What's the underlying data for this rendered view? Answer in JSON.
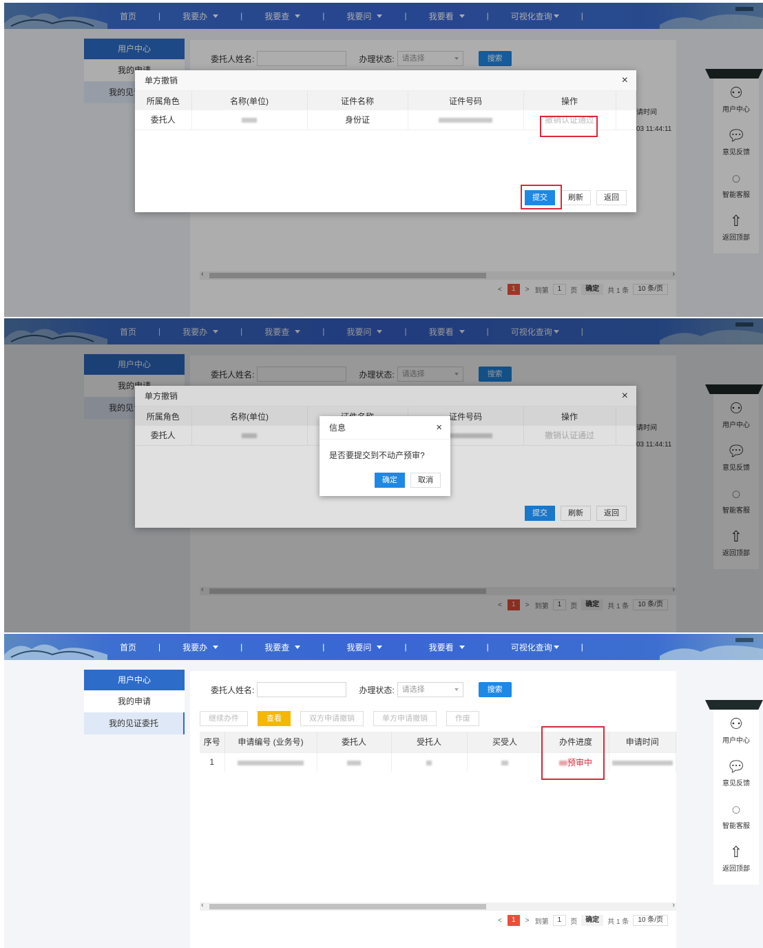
{
  "nav": {
    "items": [
      {
        "label": "首页",
        "dropdown": false
      },
      {
        "label": "我要办",
        "dropdown": true
      },
      {
        "label": "我要查",
        "dropdown": true
      },
      {
        "label": "我要问",
        "dropdown": true
      },
      {
        "label": "我要看",
        "dropdown": true
      },
      {
        "label": "可视化查询",
        "dropdown": true
      }
    ],
    "separator": "|"
  },
  "sidebar": {
    "header": "用户中心",
    "items": [
      {
        "label": "我的申请"
      },
      {
        "label": "我的见证委托"
      }
    ]
  },
  "search": {
    "client_label": "委托人姓名:",
    "status_label": "办理状态:",
    "status_placeholder": "请选择",
    "search_button": "搜索"
  },
  "toolbar": {
    "buttons": [
      "继续办件",
      "查看",
      "双方申请撤销",
      "单方申请撤销",
      "作废"
    ]
  },
  "main_table": {
    "columns": [
      "序号",
      "申请编号 (业务号)",
      "委托人",
      "受托人",
      "买受人",
      "办件进度",
      "申请时间"
    ],
    "row": {
      "index": "1",
      "progress": "预审中",
      "time_partial": "03 11:44:11"
    }
  },
  "pager": {
    "page": "1",
    "goto_label": "到第",
    "goto_value": "1",
    "page_unit": "页",
    "confirm": "确定",
    "total": "共 1 条",
    "per_page": "10 条/页"
  },
  "floatbar": {
    "items": [
      {
        "label": "用户中心",
        "icon": "user-icon"
      },
      {
        "label": "意见反馈",
        "icon": "chat-icon"
      },
      {
        "label": "智能客服",
        "icon": "headset-icon"
      },
      {
        "label": "返回顶部",
        "icon": "arrow-up-icon"
      }
    ]
  },
  "dialog": {
    "title": "单方撤销",
    "close": "×",
    "columns": [
      "所属角色",
      "名称(单位)",
      "证件名称",
      "证件号码",
      "操作"
    ],
    "row": {
      "role": "委托人",
      "cert_type": "身份证",
      "action": "撤销认证通过"
    },
    "buttons": {
      "submit": "提交",
      "refresh": "刷新",
      "back": "返回"
    }
  },
  "confirm_box": {
    "title": "信息",
    "close": "×",
    "message": "是否要提交到不动产预审?",
    "ok": "确定",
    "cancel": "取消"
  },
  "colors": {
    "nav_blue": "#3a66d4",
    "primary": "#1e88e5",
    "highlight_red": "#d9283a",
    "warn": "#f5b800"
  }
}
